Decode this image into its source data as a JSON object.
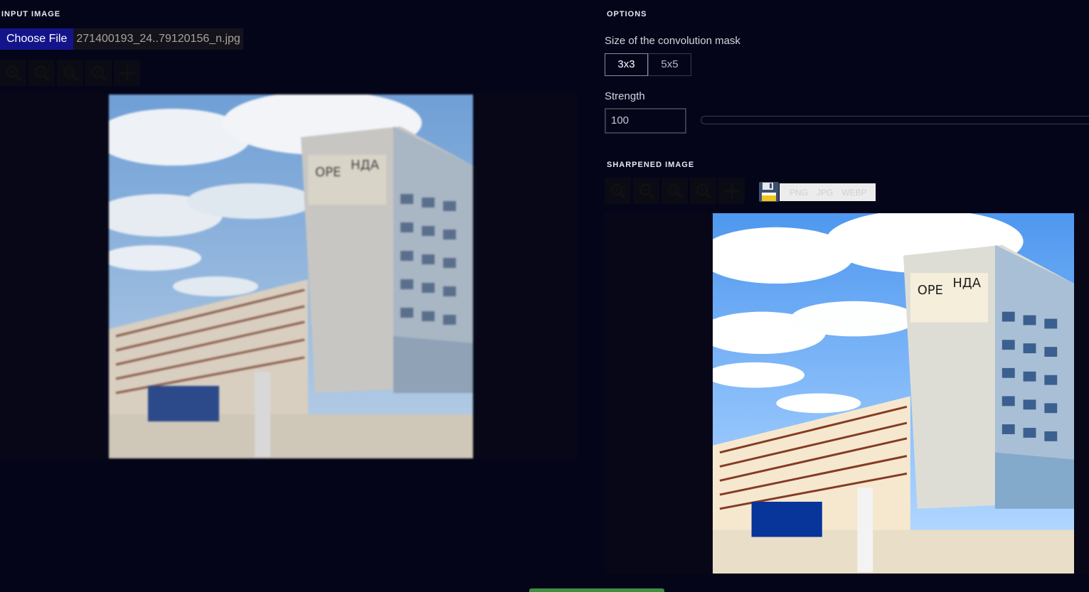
{
  "input_section": {
    "title": "INPUT IMAGE",
    "choose_file_label": "Choose File",
    "file_name": "271400193_24..79120156_n.jpg",
    "toolbar": [
      "zoom-in-icon",
      "zoom-out-icon",
      "zoom-fit-icon",
      "zoom-actual-icon",
      "move-icon"
    ]
  },
  "options_section": {
    "title": "OPTIONS",
    "mask_label": "Size of the convolution mask",
    "mask_options": [
      "3x3",
      "5x5"
    ],
    "mask_selected": "3x3",
    "strength_label": "Strength",
    "strength_value": "100"
  },
  "sharpened_section": {
    "title": "SHARPENED IMAGE",
    "toolbar": [
      "zoom-in-icon",
      "zoom-out-icon",
      "zoom-fit-icon",
      "zoom-actual-icon",
      "move-icon"
    ],
    "save_icon": "floppy-disk-icon",
    "formats": [
      "PNG",
      "JPG",
      "WEBP"
    ]
  },
  "colors": {
    "background": "#05051a",
    "choose_button": "#14148a",
    "bottom_button": "#3e8e41"
  }
}
